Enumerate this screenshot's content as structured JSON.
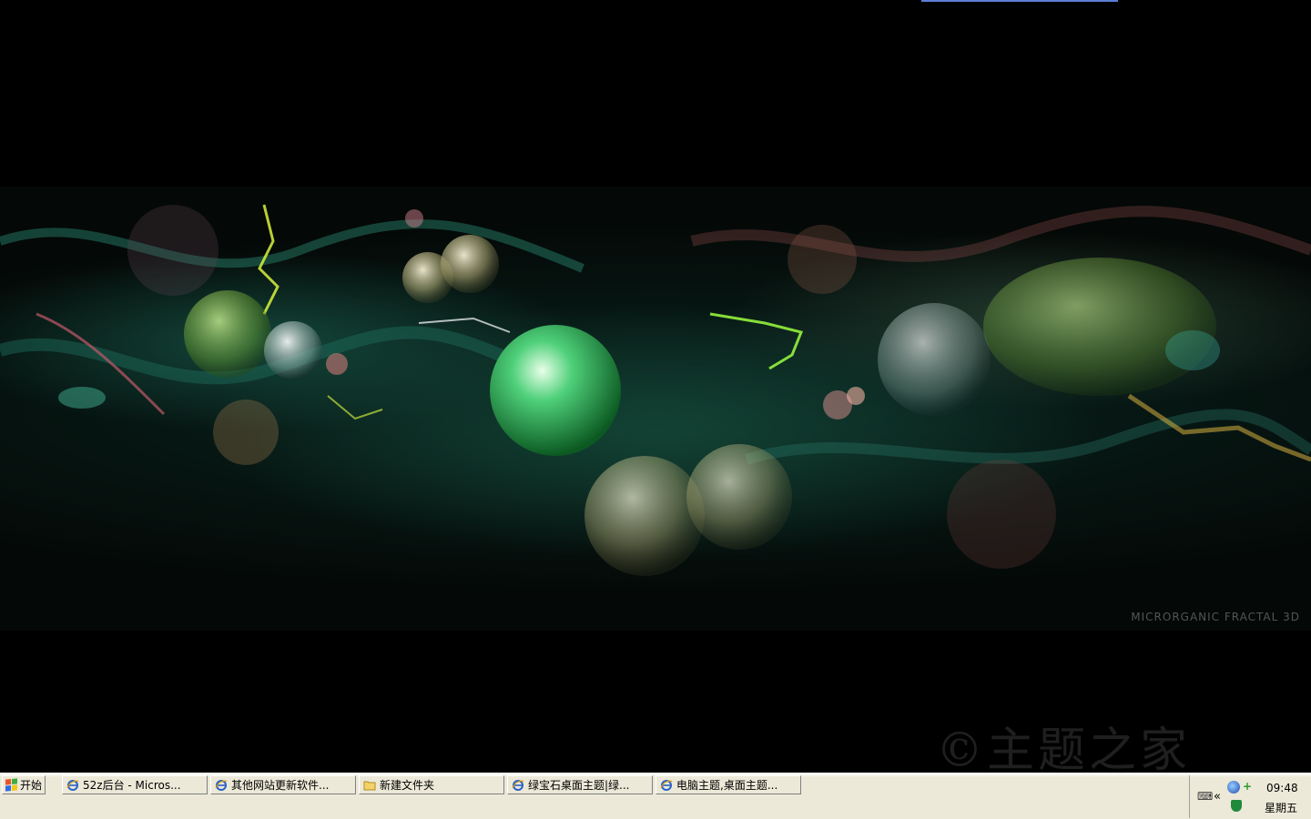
{
  "wallpaper": {
    "caption": "MICRORGANIC FRACTAL 3D",
    "watermark": "©主题之家",
    "colors": {
      "accent": "#3fbf66",
      "background": "#000000"
    }
  },
  "taskbar": {
    "start_label": "开始",
    "tasks": [
      {
        "label": "52z后台 - Micros...",
        "icon": "ie-icon"
      },
      {
        "label": "其他网站更新软件...",
        "icon": "ie-icon"
      },
      {
        "label": "新建文件夹",
        "icon": "folder-icon"
      },
      {
        "label": "绿宝石桌面主题|绿...",
        "icon": "ie-icon"
      },
      {
        "label": "电脑主题,桌面主题...",
        "icon": "ie-icon"
      }
    ],
    "tray": {
      "time": "09:48",
      "day": "星期五",
      "chevron": "«",
      "keyboard": "⌨"
    }
  }
}
